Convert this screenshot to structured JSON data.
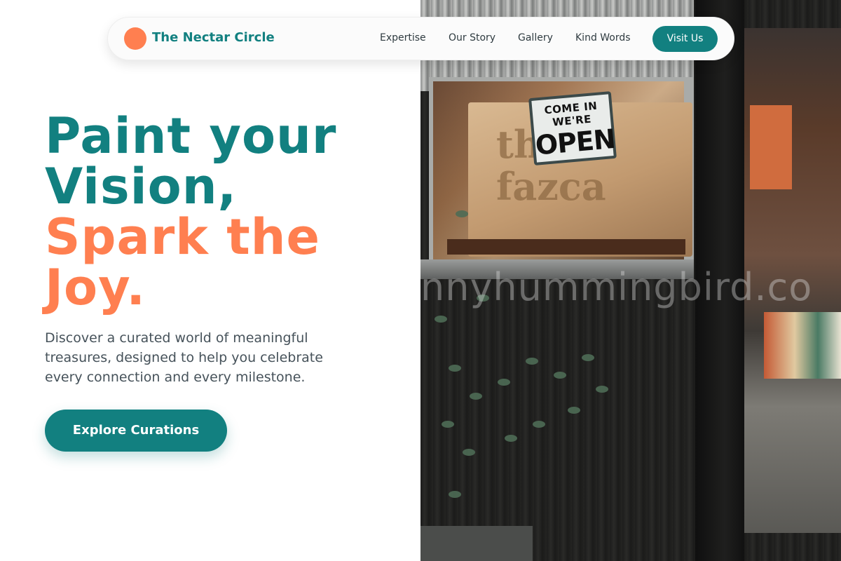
{
  "brand": {
    "name": "The Nectar Circle",
    "accent_color": "#128080",
    "logo_color": "#ff7f50"
  },
  "nav": {
    "links": [
      "Expertise",
      "Our Story",
      "Gallery",
      "Kind Words"
    ],
    "cta_label": "Visit Us"
  },
  "hero": {
    "title_line1": "Paint your",
    "title_line2": "Vision,",
    "title_line3": "Spark the",
    "title_line4": "Joy.",
    "subtitle": "Discover a curated world of meaningful treasures, designed to help you celebrate every connection and every milestone.",
    "cta_label": "Explore Curations"
  },
  "photo": {
    "sign_small": "COME IN WE'RE",
    "sign_large": "OPEN",
    "board_text": "the\nfazca",
    "watermark": "nnyhummingbird.co"
  }
}
